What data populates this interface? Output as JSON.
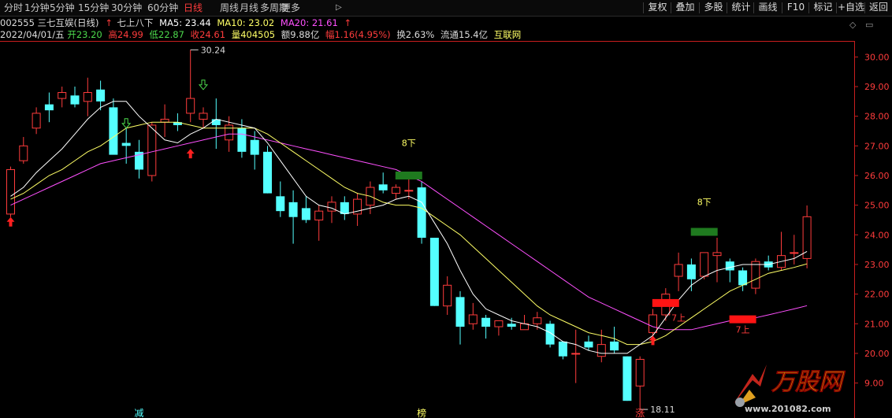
{
  "toolbar": {
    "periods": [
      "分时",
      "1分钟",
      "5分钟",
      "15分钟",
      "30分钟",
      "60分钟",
      "日线",
      "周线",
      "月线",
      "多周期",
      "更多"
    ],
    "active_period": "日线",
    "more_arrow": "▷",
    "right_buttons": [
      "复权",
      "叠加",
      "多股",
      "统计",
      "画线",
      "F10",
      "标记",
      "+自选",
      "返回"
    ]
  },
  "legend": {
    "code_name": "002555 三七互娱(日线)",
    "indicator": "七上八下",
    "ma5": "MA5: 23.44",
    "ma10": "MA10: 23.02",
    "ma20": "MA20: 21.61",
    "date": "2022/04/01/五",
    "open": "开23.20",
    "high": "高24.99",
    "low": "低22.87",
    "close": "收24.61",
    "volume": "量404505",
    "amount": "额9.88亿",
    "change": "幅1.16(4.95%)",
    "turnover": "换2.63%",
    "float_cap": "流通15.4亿",
    "board": "互联网"
  },
  "colors": {
    "up": "#ff3c3c",
    "down": "#54ffff",
    "ma5": "#ffffff",
    "ma10": "#ffff66",
    "ma20": "#ff50ff",
    "axis": "#c81e1e",
    "signal_green": "#1f7a1f",
    "signal_red": "#ff1414"
  },
  "chart_data": {
    "type": "candlestick",
    "ylim": [
      17.98,
      30.54
    ],
    "y_ticks": [
      "9.00",
      "20.00",
      "21.00",
      "22.00",
      "23.00",
      "24.00",
      "25.00",
      "26.00",
      "27.00",
      "28.00",
      "29.00",
      "30.00"
    ],
    "candles": [
      {
        "o": 24.7,
        "h": 26.3,
        "l": 24.6,
        "c": 26.2
      },
      {
        "o": 26.5,
        "h": 27.3,
        "l": 26.4,
        "c": 27.0
      },
      {
        "o": 27.6,
        "h": 28.3,
        "l": 27.4,
        "c": 28.1
      },
      {
        "o": 28.4,
        "h": 28.8,
        "l": 27.8,
        "c": 28.2
      },
      {
        "o": 28.6,
        "h": 29.0,
        "l": 28.3,
        "c": 28.8
      },
      {
        "o": 28.7,
        "h": 29.0,
        "l": 28.3,
        "c": 28.4
      },
      {
        "o": 28.5,
        "h": 29.3,
        "l": 28.0,
        "c": 28.8
      },
      {
        "o": 28.9,
        "h": 29.2,
        "l": 28.2,
        "c": 28.5
      },
      {
        "o": 28.3,
        "h": 28.6,
        "l": 26.8,
        "c": 26.7
      },
      {
        "o": 27.1,
        "h": 27.6,
        "l": 26.4,
        "c": 27.0
      },
      {
        "o": 26.8,
        "h": 27.2,
        "l": 25.9,
        "c": 26.2
      },
      {
        "o": 26.0,
        "h": 27.8,
        "l": 25.8,
        "c": 27.7
      },
      {
        "o": 27.8,
        "h": 28.4,
        "l": 27.3,
        "c": 27.9
      },
      {
        "o": 27.8,
        "h": 28.1,
        "l": 27.5,
        "c": 27.7
      },
      {
        "o": 28.1,
        "h": 30.24,
        "l": 27.8,
        "c": 28.6
      },
      {
        "o": 27.9,
        "h": 28.3,
        "l": 27.6,
        "c": 28.1
      },
      {
        "o": 27.9,
        "h": 28.6,
        "l": 26.9,
        "c": 27.7
      },
      {
        "o": 27.2,
        "h": 28.0,
        "l": 26.8,
        "c": 27.7
      },
      {
        "o": 27.6,
        "h": 27.9,
        "l": 26.6,
        "c": 26.8
      },
      {
        "o": 27.2,
        "h": 27.5,
        "l": 26.2,
        "c": 26.7
      },
      {
        "o": 26.8,
        "h": 27.0,
        "l": 25.4,
        "c": 25.4
      },
      {
        "o": 25.3,
        "h": 25.8,
        "l": 24.6,
        "c": 24.8
      },
      {
        "o": 25.1,
        "h": 25.5,
        "l": 23.7,
        "c": 24.6
      },
      {
        "o": 24.9,
        "h": 25.3,
        "l": 24.4,
        "c": 24.5
      },
      {
        "o": 24.5,
        "h": 25.0,
        "l": 23.8,
        "c": 24.8
      },
      {
        "o": 24.8,
        "h": 25.3,
        "l": 24.4,
        "c": 25.1
      },
      {
        "o": 25.1,
        "h": 25.3,
        "l": 24.5,
        "c": 24.7
      },
      {
        "o": 24.7,
        "h": 25.4,
        "l": 24.3,
        "c": 25.2
      },
      {
        "o": 25.0,
        "h": 25.8,
        "l": 24.7,
        "c": 25.6
      },
      {
        "o": 25.7,
        "h": 26.1,
        "l": 25.4,
        "c": 25.5
      },
      {
        "o": 25.4,
        "h": 25.7,
        "l": 25.2,
        "c": 25.6
      },
      {
        "o": 25.5,
        "h": 25.9,
        "l": 25.2,
        "c": 25.5
      },
      {
        "o": 25.6,
        "h": 25.8,
        "l": 23.7,
        "c": 23.9
      },
      {
        "o": 23.9,
        "h": 23.9,
        "l": 21.6,
        "c": 21.6
      },
      {
        "o": 21.6,
        "h": 22.6,
        "l": 21.3,
        "c": 22.3
      },
      {
        "o": 21.9,
        "h": 22.1,
        "l": 20.3,
        "c": 20.9
      },
      {
        "o": 21.0,
        "h": 21.7,
        "l": 20.8,
        "c": 21.3
      },
      {
        "o": 21.2,
        "h": 21.3,
        "l": 20.5,
        "c": 20.9
      },
      {
        "o": 20.9,
        "h": 21.1,
        "l": 20.6,
        "c": 21.1
      },
      {
        "o": 21.0,
        "h": 21.2,
        "l": 20.8,
        "c": 20.9
      },
      {
        "o": 20.8,
        "h": 21.3,
        "l": 20.8,
        "c": 21.0
      },
      {
        "o": 21.0,
        "h": 21.4,
        "l": 20.8,
        "c": 21.2
      },
      {
        "o": 21.0,
        "h": 21.1,
        "l": 20.2,
        "c": 20.3
      },
      {
        "o": 20.4,
        "h": 20.4,
        "l": 19.8,
        "c": 19.9
      },
      {
        "o": 20.0,
        "h": 20.8,
        "l": 19.0,
        "c": 20.0
      },
      {
        "o": 20.4,
        "h": 20.6,
        "l": 20.1,
        "c": 20.2
      },
      {
        "o": 19.9,
        "h": 20.8,
        "l": 19.7,
        "c": 20.3
      },
      {
        "o": 20.4,
        "h": 20.9,
        "l": 20.0,
        "c": 20.1
      },
      {
        "o": 19.9,
        "h": 19.9,
        "l": 18.4,
        "c": 18.4
      },
      {
        "o": 18.9,
        "h": 19.9,
        "l": 18.11,
        "c": 19.8
      },
      {
        "o": 20.7,
        "h": 21.5,
        "l": 20.6,
        "c": 21.3
      },
      {
        "o": 21.3,
        "h": 22.2,
        "l": 21.1,
        "c": 22.0
      },
      {
        "o": 22.6,
        "h": 23.4,
        "l": 22.1,
        "c": 23.0
      },
      {
        "o": 23.0,
        "h": 23.2,
        "l": 22.1,
        "c": 22.5
      },
      {
        "o": 22.6,
        "h": 23.3,
        "l": 22.5,
        "c": 23.4
      },
      {
        "o": 23.3,
        "h": 23.9,
        "l": 22.4,
        "c": 23.4
      },
      {
        "o": 23.1,
        "h": 23.2,
        "l": 22.4,
        "c": 22.8
      },
      {
        "o": 22.8,
        "h": 22.9,
        "l": 22.1,
        "c": 22.3
      },
      {
        "o": 22.2,
        "h": 23.2,
        "l": 22.0,
        "c": 23.1
      },
      {
        "o": 23.1,
        "h": 23.3,
        "l": 22.8,
        "c": 22.9
      },
      {
        "o": 22.9,
        "h": 24.1,
        "l": 22.8,
        "c": 23.3
      },
      {
        "o": 23.4,
        "h": 24.0,
        "l": 23.0,
        "c": 23.4
      },
      {
        "o": 23.2,
        "h": 24.99,
        "l": 22.87,
        "c": 24.61
      }
    ],
    "ma5": [
      25.3,
      25.6,
      26.1,
      26.5,
      26.9,
      27.4,
      27.9,
      28.3,
      28.5,
      28.5,
      28.0,
      27.6,
      27.2,
      27.1,
      27.4,
      27.6,
      27.9,
      27.8,
      27.7,
      27.6,
      27.1,
      26.5,
      25.9,
      25.3,
      25.0,
      24.9,
      24.7,
      24.8,
      24.9,
      25.0,
      25.2,
      25.3,
      25.1,
      24.4,
      23.7,
      22.8,
      22.0,
      21.5,
      21.3,
      21.1,
      21.0,
      20.9,
      20.7,
      20.4,
      20.3,
      20.1,
      20.0,
      20.0,
      20.0,
      20.3,
      20.6,
      21.2,
      21.8,
      22.3,
      22.6,
      22.8,
      22.9,
      23.0,
      23.0,
      23.0,
      23.1,
      23.2,
      23.44
    ],
    "ma10": [
      25.2,
      25.4,
      25.7,
      26.0,
      26.2,
      26.5,
      26.8,
      27.0,
      27.3,
      27.6,
      27.7,
      27.8,
      27.8,
      27.8,
      27.7,
      27.6,
      27.6,
      27.6,
      27.6,
      27.6,
      27.4,
      27.1,
      26.8,
      26.5,
      26.2,
      25.9,
      25.6,
      25.4,
      25.3,
      25.1,
      25.0,
      25.0,
      24.9,
      24.6,
      24.3,
      24.0,
      23.6,
      23.2,
      22.8,
      22.4,
      22.0,
      21.6,
      21.3,
      21.1,
      20.9,
      20.7,
      20.6,
      20.5,
      20.3,
      20.3,
      20.4,
      20.6,
      20.9,
      21.2,
      21.5,
      21.8,
      22.1,
      22.3,
      22.5,
      22.7,
      22.8,
      22.9,
      23.02
    ],
    "ma20": [
      25.0,
      25.2,
      25.4,
      25.6,
      25.8,
      26.0,
      26.2,
      26.4,
      26.5,
      26.6,
      26.7,
      26.8,
      26.9,
      27.0,
      27.1,
      27.2,
      27.3,
      27.4,
      27.4,
      27.3,
      27.2,
      27.1,
      27.0,
      26.9,
      26.8,
      26.7,
      26.6,
      26.5,
      26.4,
      26.3,
      26.2,
      26.0,
      25.8,
      25.5,
      25.2,
      24.9,
      24.6,
      24.3,
      24.0,
      23.7,
      23.4,
      23.1,
      22.8,
      22.5,
      22.2,
      21.9,
      21.7,
      21.5,
      21.3,
      21.1,
      20.9,
      20.8,
      20.8,
      20.8,
      20.9,
      21.0,
      21.1,
      21.1,
      21.2,
      21.3,
      21.4,
      21.5,
      21.61
    ],
    "annotations": [
      {
        "type": "max_label",
        "index": 14,
        "value": 30.24,
        "text": "30.24"
      },
      {
        "type": "min_label",
        "index": 49,
        "value": 18.11,
        "text": "18.11"
      },
      {
        "type": "signal_text",
        "index": 31,
        "value": 27.0,
        "text": "8下",
        "color": "#ffff66"
      },
      {
        "type": "signal_bar",
        "index": 31,
        "value": 26.0,
        "color": "#1f7a1f"
      },
      {
        "type": "signal_text",
        "index": 54,
        "value": 25.0,
        "text": "8下",
        "color": "#ffff66"
      },
      {
        "type": "signal_bar",
        "index": 54,
        "value": 24.1,
        "color": "#1f7a1f"
      },
      {
        "type": "signal_bar",
        "index": 51,
        "value": 21.7,
        "color": "#ff1414"
      },
      {
        "type": "signal_text",
        "index": 52,
        "value": 21.1,
        "text": "7上",
        "color": "#ff3c3c"
      },
      {
        "type": "signal_bar",
        "index": 57,
        "value": 21.15,
        "color": "#ff1414"
      },
      {
        "type": "signal_text",
        "index": 57,
        "value": 20.7,
        "text": "7上",
        "color": "#ff3c3c"
      },
      {
        "type": "up_arrow",
        "index": 0,
        "value": 24.6
      },
      {
        "type": "up_arrow",
        "index": 14,
        "value": 26.9
      },
      {
        "type": "up_arrow",
        "index": 50,
        "value": 20.6
      },
      {
        "type": "down_arrow",
        "index": 9,
        "value": 27.6
      },
      {
        "type": "down_arrow",
        "index": 15,
        "value": 28.9
      }
    ],
    "bottom_marks": [
      {
        "index": 10,
        "text": "减",
        "color": "#54ffff"
      },
      {
        "index": 32,
        "text": "榜",
        "color": "#ffff66"
      },
      {
        "index": 49,
        "text": "涨",
        "color": "#ff3c3c"
      }
    ]
  },
  "watermark": {
    "brand": "万股网",
    "url": "www.201082.com"
  }
}
